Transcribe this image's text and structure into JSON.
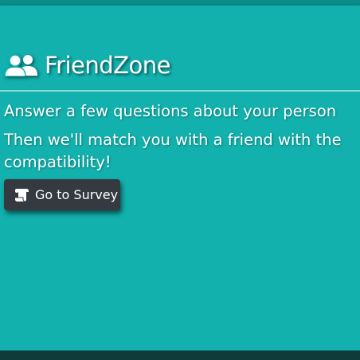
{
  "brand": {
    "icon": "users-icon",
    "title": "FriendZone"
  },
  "intro": {
    "line1": "Answer a few questions about your person",
    "line2": "Then we'll match you with a friend with the",
    "line3": "compatibility!"
  },
  "cta": {
    "icon": "scroll-icon",
    "label": "Go to Survey"
  },
  "colors": {
    "panel": "#12b1ad",
    "button": "#343a40",
    "text": "#ffffff"
  }
}
